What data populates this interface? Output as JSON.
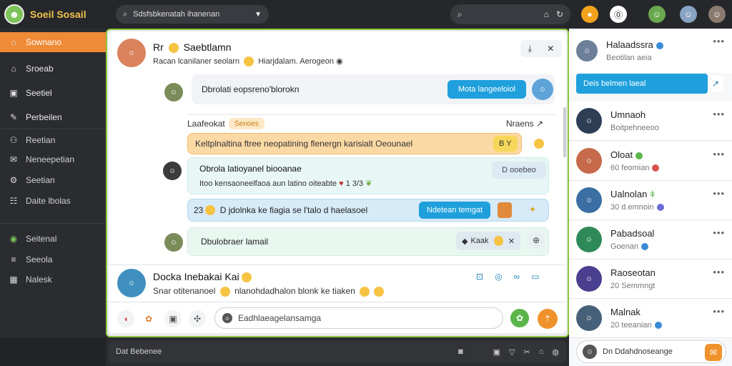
{
  "app": {
    "name": "Soeil Sosail"
  },
  "topbar": {
    "search_text": "Sdsfsbkenatah ihanenan",
    "icons": [
      "search-icon",
      "home-icon",
      "refresh-icon",
      "coin-icon",
      "notification-icon",
      "user-icon",
      "user-icon",
      "user-icon"
    ]
  },
  "sidebar": {
    "items": [
      {
        "label": "Sownano",
        "icon": "home-icon",
        "active": true
      },
      {
        "label": "Sroeab",
        "icon": "home-icon"
      },
      {
        "label": "Seetiel",
        "icon": "lock-icon"
      },
      {
        "label": "Perbeilen",
        "icon": "edit-icon"
      },
      {
        "label": "Reetian",
        "icon": "people-icon"
      },
      {
        "label": "Neneepetian",
        "icon": "chat-icon"
      },
      {
        "label": "Seetian",
        "icon": "settings-icon"
      },
      {
        "label": "Daite lbolas",
        "icon": "grid-icon"
      },
      {
        "label": "Seitenal",
        "icon": "circle-icon"
      },
      {
        "label": "Seeola",
        "icon": "list-icon"
      },
      {
        "label": "Nalesk",
        "icon": "grid-icon"
      }
    ]
  },
  "chat": {
    "header": {
      "title": "Rr",
      "name": "Saebtlamn",
      "subtitle": "Racan lcanilaner seolarn",
      "subtitle2": "Hiarjdalam. Aerogeon"
    },
    "messages": [
      {
        "text": "Dbrolati eopsreno'blorokn",
        "button": "Mota langeeloiol"
      },
      {
        "label": "Laafeokat",
        "tag": "Senoes",
        "right": "Nraens"
      },
      {
        "text": "Keltplnaltina ftree neopatining flenergn karisialt Oeounael",
        "badge": "B Y"
      },
      {
        "title": "Obrola latioyanel biooanae",
        "text": "Itoo kensaoneelfaoa aun latino oiteabte",
        "meta": "1 3/3",
        "side": "D ooebeo"
      },
      {
        "num": "23",
        "text": "D jdolnka ke fiagia se l'talo d haelasoel",
        "button": "Ndetean temgat"
      },
      {
        "text": "Dbulobraer lamail",
        "action": "Kaak"
      }
    ],
    "composer_top": {
      "name": "Docka Inebakai Kai",
      "text": "Snar otitenanoel",
      "text2": "nlanohdadhalon blonk ke tiaken"
    },
    "composer": {
      "placeholder": "Eadhlaeagelansamga"
    }
  },
  "bottom": {
    "text": "Dat Bebenee"
  },
  "right": {
    "top": {
      "name": "Halaadssra",
      "sub": "Beotilan aeia"
    },
    "cta": "Deis belmen laeal",
    "contacts": [
      {
        "name": "Umnaoh",
        "sub": "Boitpehneeoo"
      },
      {
        "name": "Oloat",
        "sub": "60 feomian"
      },
      {
        "name": "Ualnolan",
        "sub": "30 d.emnoin"
      },
      {
        "name": "Pabadsoal",
        "sub": "Goenan"
      },
      {
        "name": "Raoseotan",
        "sub": "20 Semmngt"
      },
      {
        "name": "Malnak",
        "sub": "20 teeanian"
      }
    ],
    "footer": {
      "text": "Dn Ddahdnoseange"
    }
  }
}
